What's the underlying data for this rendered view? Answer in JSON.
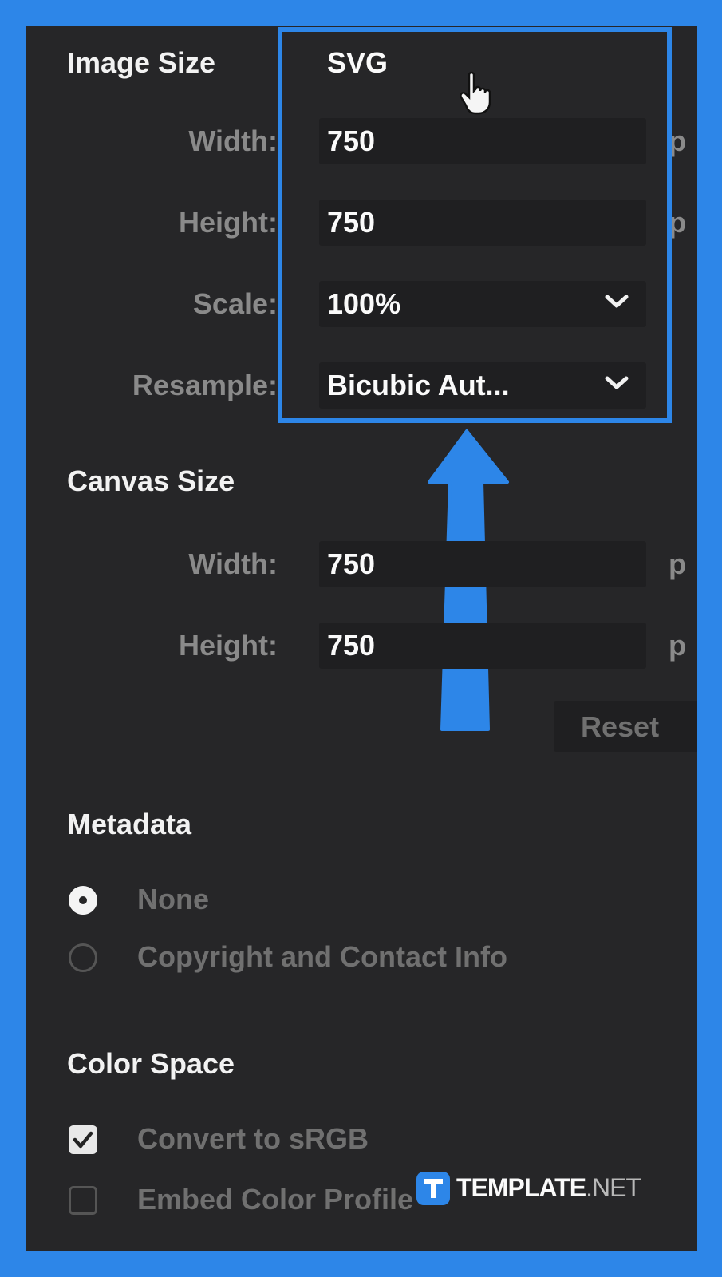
{
  "image_size": {
    "heading": "Image Size",
    "format": "SVG",
    "width_label": "Width:",
    "width_value": "750",
    "height_label": "Height:",
    "height_value": "750",
    "scale_label": "Scale:",
    "scale_value": "100%",
    "resample_label": "Resample:",
    "resample_value": "Bicubic Aut...",
    "unit_partial": "p"
  },
  "canvas_size": {
    "heading": "Canvas Size",
    "width_label": "Width:",
    "width_value": "750",
    "height_label": "Height:",
    "height_value": "750",
    "unit_partial": "p",
    "reset_label": "Reset"
  },
  "metadata": {
    "heading": "Metadata",
    "options": [
      "None",
      "Copyright and Contact Info"
    ],
    "selected": "None"
  },
  "color_space": {
    "heading": "Color Space",
    "options": [
      {
        "label": "Convert to sRGB",
        "checked": true
      },
      {
        "label": "Embed Color Profile",
        "checked": false
      }
    ]
  },
  "watermark": {
    "brand_bold": "TEMPLATE",
    "brand_light": ".NET"
  },
  "colors": {
    "highlight": "#2d86e8",
    "panel_bg": "#262628"
  },
  "icons": [
    "hand-pointer-icon",
    "chevron-down-icon",
    "arrow-up-icon",
    "checkmark-icon",
    "template-logo-icon"
  ]
}
